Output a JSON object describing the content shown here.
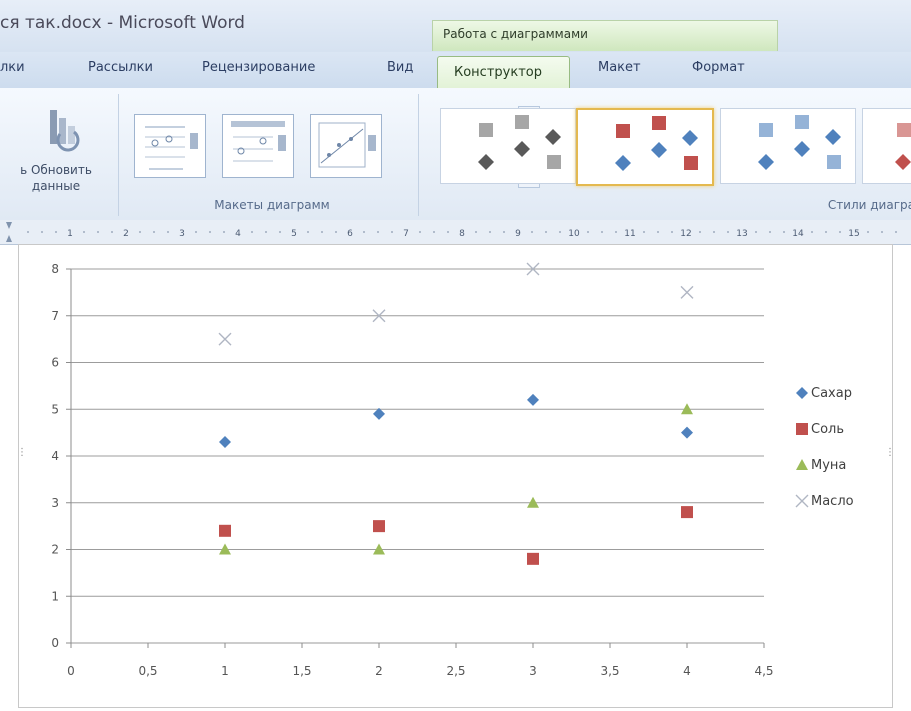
{
  "window": {
    "title": "ся так.docx - Microsoft Word",
    "context_group": "Работа с диаграммами"
  },
  "tabs": [
    {
      "label": "лки"
    },
    {
      "label": "Рассылки"
    },
    {
      "label": "Рецензирование"
    },
    {
      "label": "Вид"
    },
    {
      "label": "Конструктор",
      "active": true
    },
    {
      "label": "Макет"
    },
    {
      "label": "Формат"
    }
  ],
  "ribbon": {
    "update_button": {
      "line1": "ь Обновить",
      "line2": "данные"
    },
    "layouts_group_label": "Макеты диаграмм",
    "styles_group_label": "Стили диагра"
  },
  "ruler": {
    "labels": [
      "1",
      "2",
      "3",
      "4",
      "5",
      "6",
      "7",
      "8",
      "9",
      "10",
      "11",
      "12",
      "13",
      "14",
      "15"
    ]
  },
  "colors": {
    "sugar": "#4f81bd",
    "salt": "#c0504d",
    "flour": "#9bbb59",
    "oil": "#b0b6c3",
    "styleGray": "#a6a6a6",
    "styleDark": "#595959"
  },
  "chart_data": {
    "type": "scatter",
    "xlim": [
      0,
      4.5
    ],
    "ylim": [
      0,
      8
    ],
    "x_ticks": [
      "0",
      "0,5",
      "1",
      "1,5",
      "2",
      "2,5",
      "3",
      "3,5",
      "4",
      "4,5"
    ],
    "y_ticks": [
      "0",
      "1",
      "2",
      "3",
      "4",
      "5",
      "6",
      "7",
      "8"
    ],
    "grid": true,
    "legend_position": "right",
    "series": [
      {
        "name": "Сахар",
        "marker": "diamond",
        "points": [
          [
            1,
            4.3
          ],
          [
            2,
            4.9
          ],
          [
            3,
            5.2
          ],
          [
            4,
            4.5
          ]
        ]
      },
      {
        "name": "Соль",
        "marker": "square",
        "points": [
          [
            1,
            2.4
          ],
          [
            2,
            2.5
          ],
          [
            3,
            1.8
          ],
          [
            4,
            2.8
          ]
        ]
      },
      {
        "name": "Муна",
        "marker": "triangle",
        "points": [
          [
            1,
            2.0
          ],
          [
            2,
            2.0
          ],
          [
            3,
            3.0
          ],
          [
            4,
            5.0
          ]
        ]
      },
      {
        "name": "Масло",
        "marker": "x",
        "points": [
          [
            1,
            6.5
          ],
          [
            2,
            7.0
          ],
          [
            3,
            8.0
          ],
          [
            4,
            7.5
          ]
        ]
      }
    ]
  }
}
